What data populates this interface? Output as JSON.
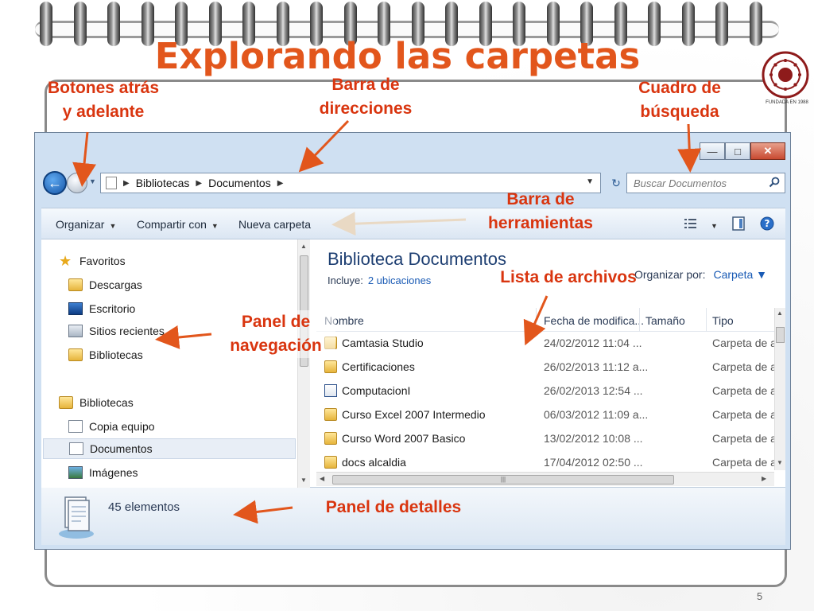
{
  "slide": {
    "title": "Explorando las carpetas",
    "logo_caption": "FUNDADA EN 1988",
    "logo_text_top": "UNIVERSIDAD DEL VALLE",
    "logo_text_bottom": "BOLIVIA",
    "page_number": "5"
  },
  "annotations": {
    "back_forward": [
      "Botones atrás",
      "y adelante"
    ],
    "address_bar": [
      "Barra de",
      "direcciones"
    ],
    "search_box": [
      "Cuadro de",
      "búsqueda"
    ],
    "toolbar": [
      "Barra de",
      "herramientas"
    ],
    "file_list": "Lista de archivos",
    "nav_pane": [
      "Panel de",
      "navegación"
    ],
    "details_pane": "Panel de detalles"
  },
  "window": {
    "address": {
      "crumbs": [
        "Bibliotecas",
        "Documentos"
      ]
    },
    "search": {
      "placeholder": "Buscar Documentos"
    },
    "toolbar": {
      "organize": "Organizar",
      "share": "Compartir con",
      "new_folder": "Nueva carpeta"
    },
    "nav_pane": {
      "favorites": "Favoritos",
      "favorites_items": [
        "Descargas",
        "Escritorio",
        "Sitios recientes",
        "Bibliotecas"
      ],
      "libraries": "Bibliotecas",
      "libraries_items": [
        "Copia equipo",
        "Documentos",
        "Imágenes"
      ]
    },
    "library": {
      "title": "Biblioteca Documentos",
      "includes_label": "Incluye:",
      "includes_link": "2 ubicaciones",
      "arrange_label": "Organizar por:",
      "arrange_value": "Carpeta"
    },
    "columns": [
      "Nombre",
      "Fecha de modifica...",
      "Tamaño",
      "Tipo"
    ],
    "files": [
      {
        "name": "Camtasia Studio",
        "date": "24/02/2012 11:04 ...",
        "type": "Carpeta de a"
      },
      {
        "name": "Certificaciones",
        "date": "26/02/2013 11:12 a...",
        "type": "Carpeta de a"
      },
      {
        "name": "ComputacionI",
        "date": "26/02/2013 12:54 ...",
        "type": "Carpeta de a"
      },
      {
        "name": "Curso Excel 2007 Intermedio",
        "date": "06/03/2012 11:09 a...",
        "type": "Carpeta de a"
      },
      {
        "name": "Curso Word 2007 Basico",
        "date": "13/02/2012 10:08 ...",
        "type": "Carpeta de a"
      },
      {
        "name": "docs alcaldia",
        "date": "17/04/2012 02:50 ...",
        "type": "Carpeta de a"
      }
    ],
    "details": {
      "count": "45 elementos"
    }
  },
  "colors": {
    "accent": "#e2561c",
    "annotation": "#d9350f",
    "window_frame": "#cfe0f2"
  }
}
